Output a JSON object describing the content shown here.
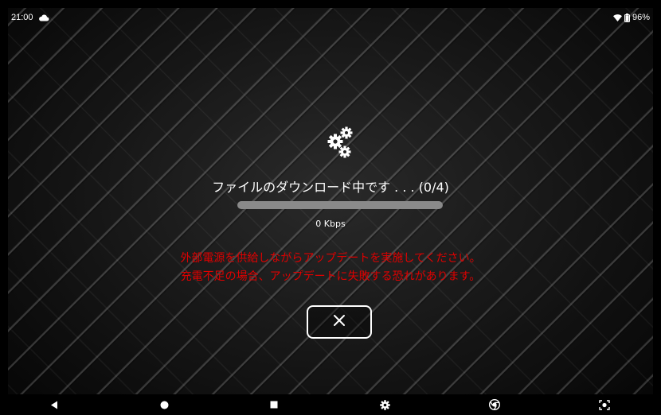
{
  "status_bar": {
    "time": "21:00",
    "battery_percent": "96%",
    "icons": [
      "cloud-icon",
      "wifi-icon",
      "battery-icon"
    ]
  },
  "download": {
    "status_text": "ファイルのダウンロード中です . . . (0/4)",
    "progress": 0,
    "speed": "0 Kbps",
    "icon": "gears-icon"
  },
  "warning": {
    "line1": "外部電源を供給しながらアップデートを実施してください。",
    "line2": "充電不足の場合、アップデートに失敗する恐れがあります。",
    "color": "#e00000"
  },
  "cancel": {
    "icon": "close-icon"
  },
  "nav_bar": {
    "items": [
      "back-icon",
      "home-icon",
      "recents-icon",
      "settings-icon",
      "chrome-icon",
      "screenshot-icon"
    ]
  }
}
